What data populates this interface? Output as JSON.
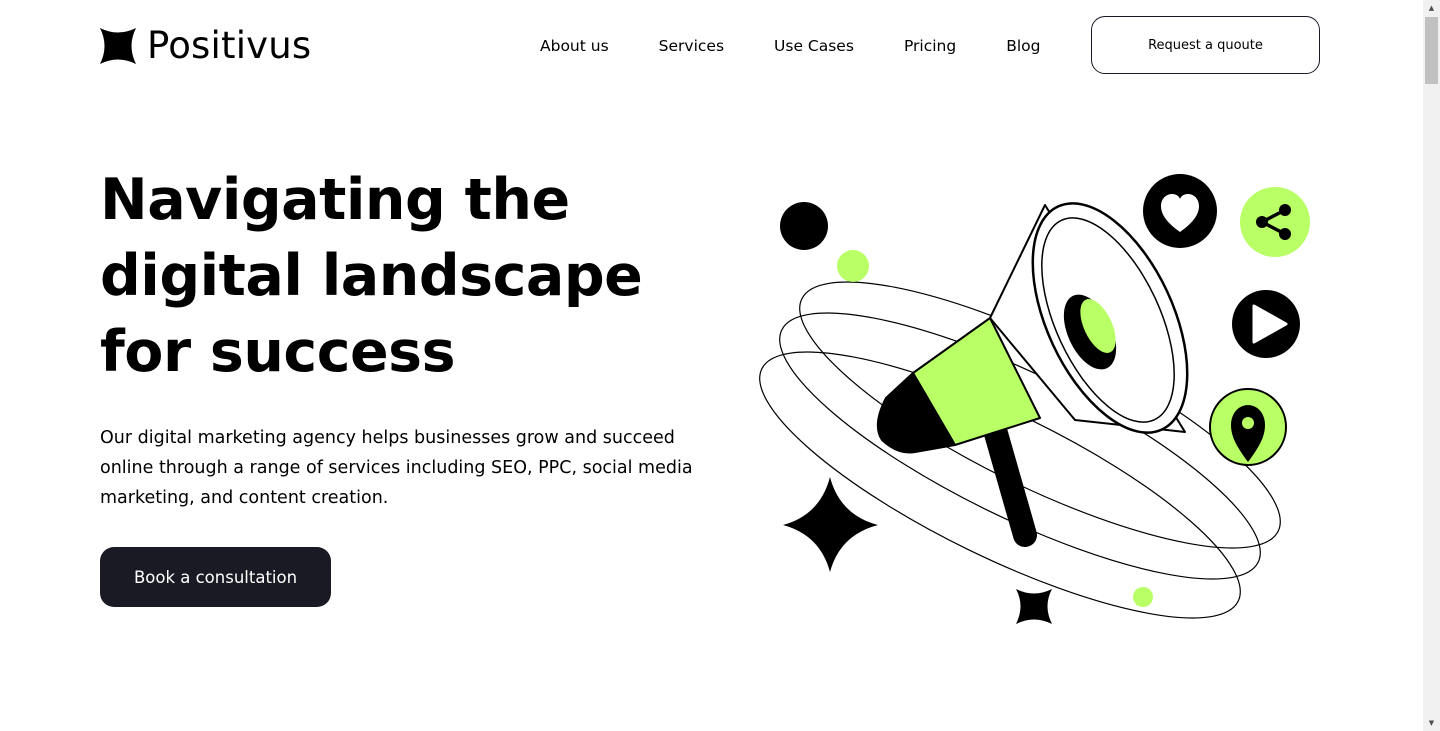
{
  "brand": {
    "name": "Positivus"
  },
  "nav": {
    "links": [
      "About us",
      "Services",
      "Use Cases",
      "Pricing",
      "Blog"
    ],
    "cta": "Request a quoute"
  },
  "hero": {
    "title_lines": [
      "Navigating the",
      "digital landscape",
      "for success"
    ],
    "description": "Our digital marketing agency helps businesses grow and succeed online through a range of services including SEO, PPC, social media marketing, and content creation.",
    "cta": "Book a consultation"
  },
  "illustration": {
    "icons": [
      "megaphone-icon",
      "heart-icon",
      "share-icon",
      "play-icon",
      "location-pin-icon",
      "sparkle-star-icon"
    ]
  },
  "colors": {
    "accent": "#B9FF66",
    "dark": "#191A23",
    "background": "#FFFFFF"
  }
}
